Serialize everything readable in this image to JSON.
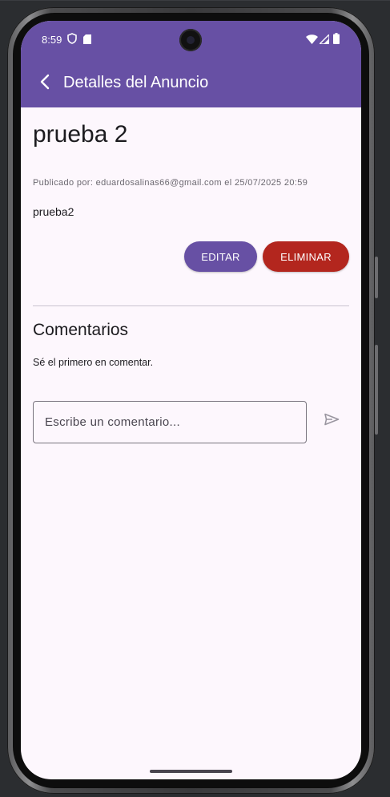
{
  "status_bar": {
    "time": "8:59",
    "left_icons": [
      "shield-icon",
      "sim-card-icon"
    ],
    "right_icons": [
      "wifi-icon",
      "cellular-signal-icon",
      "battery-icon"
    ]
  },
  "app_bar": {
    "title": "Detalles del Anuncio",
    "back_icon": "arrow-back-icon"
  },
  "post": {
    "title": "prueba 2",
    "meta": "Publicado por: eduardosalinas66@gmail.com el 25/07/2025 20:59",
    "body": "prueba2"
  },
  "actions": {
    "edit_label": "EDITAR",
    "delete_label": "ELIMINAR"
  },
  "comments": {
    "heading": "Comentarios",
    "empty_text": "Sé el primero en comentar.",
    "input_value": "",
    "input_placeholder": "Escribe un comentario...",
    "send_icon": "send-icon"
  },
  "colors": {
    "primary": "#6750a4",
    "danger": "#b3261e",
    "background": "#fdf7fd",
    "on_surface": "#1c1b1f",
    "outline": "#79747e",
    "divider": "#cac4d0"
  }
}
